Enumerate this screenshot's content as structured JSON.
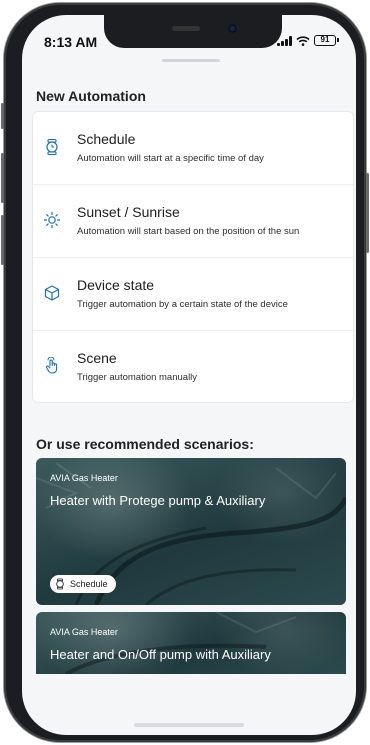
{
  "status_bar": {
    "time": "8:13 AM",
    "battery": "91"
  },
  "page": {
    "title": "New Automation"
  },
  "options": [
    {
      "icon": "watch-icon",
      "title": "Schedule",
      "description": "Automation will start at a specific time of day"
    },
    {
      "icon": "sun-icon",
      "title": "Sunset / Sunrise",
      "description": "Automation will start based on the position of the sun"
    },
    {
      "icon": "cube-icon",
      "title": "Device state",
      "description": "Trigger automation by a certain state of the device"
    },
    {
      "icon": "hand-touch-icon",
      "title": "Scene",
      "description": "Trigger automation manually"
    }
  ],
  "recommended": {
    "title": "Or use recommended scenarios:",
    "cards": [
      {
        "brand": "AVIA Gas Heater",
        "title": "Heater with Protege pump & Auxiliary",
        "tag": "Schedule",
        "tag_icon": "watch-icon"
      },
      {
        "brand": "AVIA Gas Heater",
        "title": "Heater and On/Off pump with Auxiliary"
      }
    ]
  },
  "colors": {
    "accent": "#1f6fb2",
    "background": "#f4f6f7",
    "card": "#ffffff"
  }
}
